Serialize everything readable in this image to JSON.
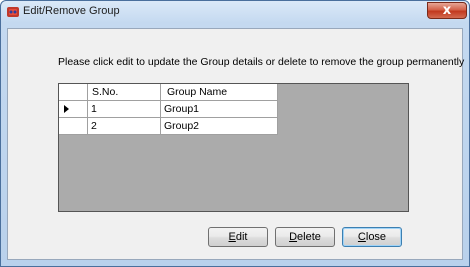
{
  "window": {
    "title": "Edit/Remove Group",
    "close_glyph": "x"
  },
  "instruction": "Please click edit to update the Group details  or  delete to remove the group permanently",
  "grid": {
    "columns": [
      "S.No.",
      "Group Name"
    ],
    "rows": [
      {
        "sno": "1",
        "name": "Group1",
        "current": true
      },
      {
        "sno": "2",
        "name": "Group2",
        "current": false
      }
    ]
  },
  "buttons": {
    "edit": {
      "mnemonic": "E",
      "rest": "dit"
    },
    "delete": {
      "mnemonic": "D",
      "rest": "elete"
    },
    "close": {
      "mnemonic": "C",
      "rest": "lose"
    }
  },
  "colors": {
    "title_bar": "#c4d9f0",
    "close_button": "#c2391f",
    "grid_background": "#ababab"
  }
}
